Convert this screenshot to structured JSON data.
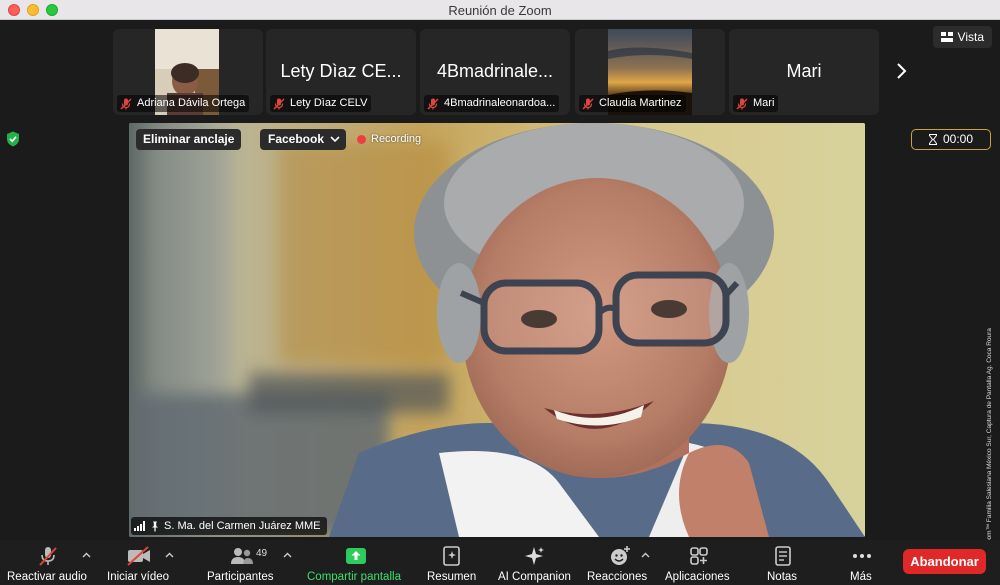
{
  "window": {
    "title": "Reunión de Zoom"
  },
  "view_button": {
    "label": "Vista",
    "icon": "grid-icon"
  },
  "participants_strip": [
    {
      "name": "Adriana Dávila Ortega",
      "has_video": true,
      "muted": true
    },
    {
      "name": "Lety Dìaz CELV",
      "display": "Lety Dìaz CE...",
      "muted": true
    },
    {
      "name": "4Bmadrinaleonardoa...",
      "display": "4Bmadrinale...",
      "muted": true
    },
    {
      "name": "Claudia Martinez",
      "has_video": true,
      "muted": true
    },
    {
      "name": "Mari",
      "display": "Mari",
      "muted": true
    }
  ],
  "main": {
    "unpin_label": "Eliminar anclaje",
    "stream_label": "Facebook",
    "recording_label": "Recording",
    "timer": "00:00",
    "speaker_name": "S. Ma. del Carmen Juárez MME",
    "side_caption": "Cortesía © Zoom™ Familia Salesiana México Sur, Captura de Pantalla Ag. Coca Roura"
  },
  "toolbar": {
    "audio_label": "Reactivar audio",
    "video_label": "Iniciar vídeo",
    "participants_label": "Participantes",
    "participants_count": "49",
    "share_label": "Compartir pantalla",
    "summary_label": "Resumen",
    "ai_label": "AI Companion",
    "reactions_label": "Reacciones",
    "apps_label": "Aplicaciones",
    "notes_label": "Notas",
    "more_label": "Más",
    "leave_label": "Abandonar"
  },
  "colors": {
    "background": "#1b1b1b",
    "tile": "#262626",
    "leave": "#e02828",
    "share": "#3be06a",
    "recording": "#ef3e3e",
    "timer_border": "#c9a33d",
    "mic_off": "#e0443e"
  }
}
